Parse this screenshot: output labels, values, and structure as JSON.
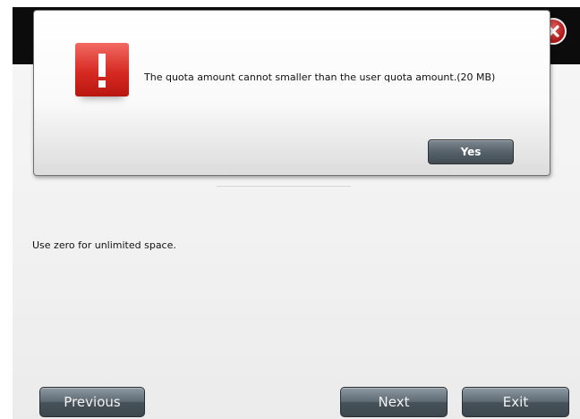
{
  "wizard": {
    "hint_text": "Use zero for unlimited space.",
    "buttons": {
      "previous": "Previous",
      "next": "Next",
      "exit": "Exit"
    },
    "close_icon": "close-icon"
  },
  "alert_dialog": {
    "icon": "exclamation-icon",
    "message": "The quota amount cannot smaller than the user quota amount.(20 MB)",
    "yes_label": "Yes"
  },
  "colors": {
    "header": "#0c0c0c",
    "alert_red": "#d62a22",
    "button_gray": "#56626a"
  }
}
